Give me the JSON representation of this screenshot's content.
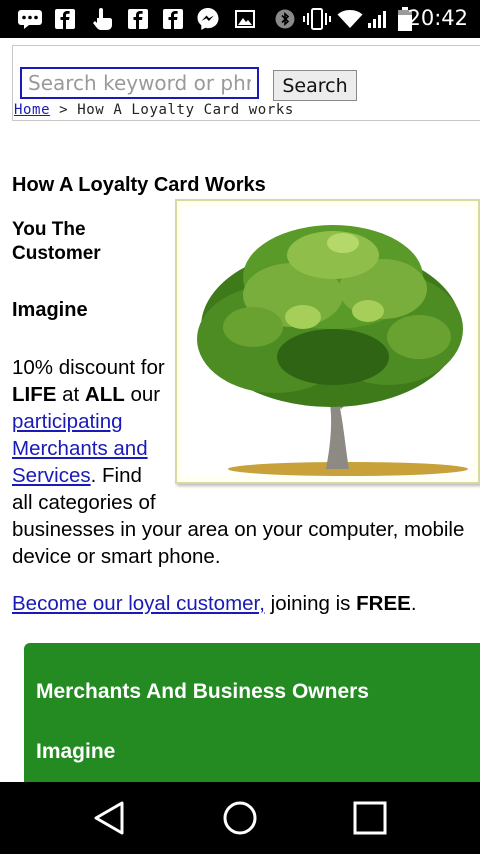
{
  "status_bar": {
    "time": "20:42",
    "left_icons": [
      "chat-bubble-icon",
      "facebook-icon",
      "hand-touch-icon",
      "facebook-icon",
      "facebook-icon",
      "messenger-icon",
      "gallery-icon"
    ],
    "right_icons": [
      "bluetooth-icon",
      "vibrate-icon",
      "wifi-icon",
      "signal-icon",
      "battery-icon"
    ]
  },
  "search": {
    "placeholder": "Search keyword or phrase",
    "button_label": "Search"
  },
  "breadcrumb": {
    "home": "Home",
    "separator": ">",
    "current": "How A Loyalty Card works"
  },
  "content": {
    "title": "How A Loyalty Card Works",
    "subtitle": "You The Customer",
    "imagine": "Imagine",
    "para_a": "10% discount for ",
    "para_life": "LIFE",
    "para_b": " at ",
    "para_all": "ALL",
    "para_c": " our ",
    "participating_link": "participating Merchants and Services",
    "para_d": ". Find all categories of businesses in your area on your computer, mobile device or smart phone.",
    "become_link": "Become our loyal customer,",
    "join_text": " joining is ",
    "free": "FREE",
    "period": "."
  },
  "merchants_panel": {
    "title": "Merchants And Business Owners",
    "imagine": "Imagine"
  },
  "nav_bar": {
    "icons": [
      "back-icon",
      "home-icon",
      "recents-icon"
    ]
  },
  "colors": {
    "link": "#1a1ab8",
    "panel_green": "#238b22",
    "status_bar": "#000000"
  }
}
